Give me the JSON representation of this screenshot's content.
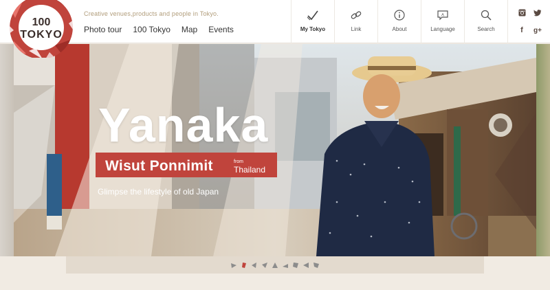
{
  "site": {
    "logo_text": [
      "100",
      "TOKYO"
    ],
    "tagline": "Creative venues,products and people in Tokyo."
  },
  "mainnav": [
    "Photo tour",
    "100 Tokyo",
    "Map",
    "Events"
  ],
  "iconnav": [
    {
      "label": "My Tokyo",
      "icon": "check-icon",
      "active": true
    },
    {
      "label": "Link",
      "icon": "link-icon",
      "active": false
    },
    {
      "label": "About",
      "icon": "info-icon",
      "active": false
    },
    {
      "label": "Language",
      "icon": "speech-bubble-icon",
      "active": false
    },
    {
      "label": "Search",
      "icon": "search-icon",
      "active": false
    }
  ],
  "social": [
    "instagram-icon",
    "twitter-icon",
    "facebook-icon",
    "google-plus-icon"
  ],
  "social_glyphs": {
    "facebook": "f",
    "google_plus": "g+"
  },
  "hero": {
    "title": "Yanaka",
    "name": "Wisut Ponnimit",
    "from_label": "from",
    "country": "Thailand",
    "subtitle": "Glimpse the lifestyle of old Japan"
  },
  "pager": {
    "count": 9,
    "active_index": 1
  },
  "colors": {
    "brand_red": "#c0443c",
    "tagline": "#b09c7a",
    "pager_bg": "#e3dace",
    "page_bg": "#f1ebe3"
  }
}
